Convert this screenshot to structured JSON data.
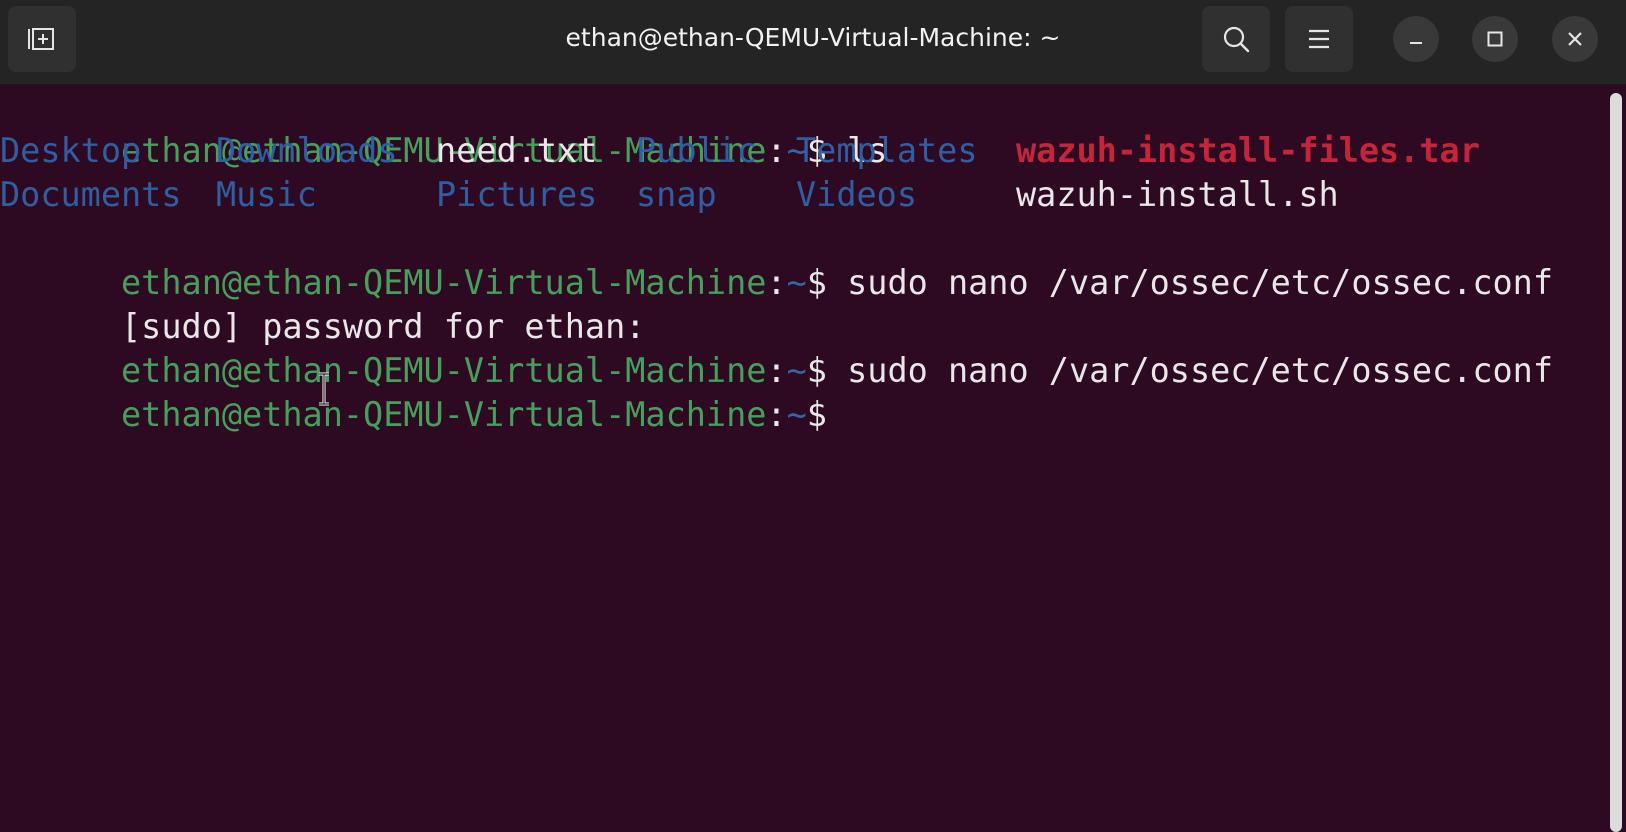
{
  "window": {
    "title": "ethan@ethan-QEMU-Virtual-Machine: ~"
  },
  "titlebar": {
    "new_tab_icon": "new-tab-icon",
    "search_icon": "search-icon",
    "menu_icon": "hamburger-menu-icon",
    "minimize_icon": "minimize-icon",
    "maximize_icon": "maximize-icon",
    "close_icon": "close-icon"
  },
  "prompt": {
    "user_host": "ethan@ethan-QEMU-Virtual-Machine",
    "separator": ":",
    "path": "~",
    "dollar": "$"
  },
  "lines": {
    "cmd1": " ls",
    "ls_row1": {
      "desktop": "Desktop",
      "downloads": "Downloads",
      "need_txt": "need.txt",
      "public": "Public",
      "templates": "Templates",
      "wazuh_tar": "wazuh-install-files.tar"
    },
    "ls_row2": {
      "documents": "Documents",
      "music": "Music",
      "pictures": "Pictures",
      "snap": "snap",
      "videos": "Videos",
      "wazuh_sh": "wazuh-install.sh"
    },
    "cmd2": " sudo nano /var/ossec/etc/ossec.conf",
    "sudo_prompt": "[sudo] password for ethan:",
    "cmd3": " sudo nano /var/ossec/etc/ossec.conf"
  },
  "colors": {
    "background": "#2d0922",
    "prompt_user": "#46a05c",
    "directory": "#2f5ea3",
    "archive": "#c4253a",
    "text": "#e8e8e8"
  }
}
